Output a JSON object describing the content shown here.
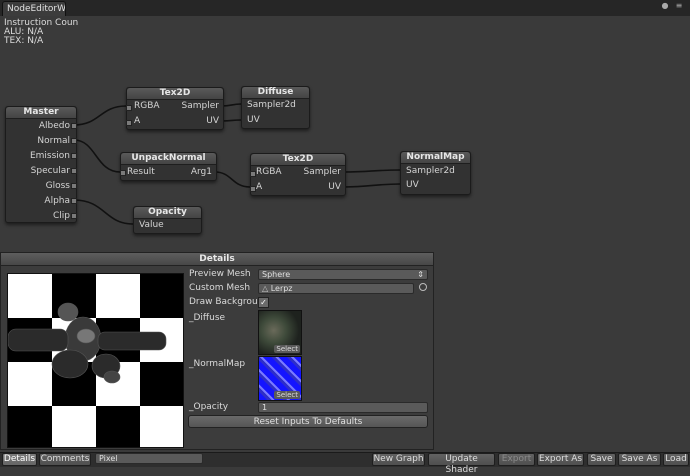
{
  "window": {
    "tab_title": "NodeEditorWin…"
  },
  "info": {
    "instruction": "Instruction Coun",
    "alu": "ALU: N/A",
    "tex": "TEX: N/A"
  },
  "nodes": {
    "master": {
      "title": "Master",
      "inputs": [
        "Albedo",
        "Normal",
        "Emission",
        "Specular",
        "Gloss",
        "Alpha",
        "Clip"
      ]
    },
    "tex2d_a": {
      "title": "Tex2D",
      "inputs": [
        "RGBA",
        "A"
      ],
      "outputs": [
        "Sampler",
        "UV"
      ]
    },
    "diffuse": {
      "title": "Diffuse",
      "outputs": [
        "Sampler2d",
        "UV"
      ]
    },
    "unpack": {
      "title": "UnpackNormal",
      "inputs": [
        "Result"
      ],
      "outputs": [
        "Arg1"
      ]
    },
    "tex2d_b": {
      "title": "Tex2D",
      "inputs": [
        "RGBA",
        "A"
      ],
      "outputs": [
        "Sampler",
        "UV"
      ]
    },
    "normalmap": {
      "title": "NormalMap",
      "outputs": [
        "Sampler2d",
        "UV"
      ]
    },
    "opacity": {
      "title": "Opacity",
      "outputs": [
        "Value"
      ]
    }
  },
  "details": {
    "title": "Details",
    "preview_mesh_label": "Preview Mesh",
    "preview_mesh_value": "Sphere",
    "custom_mesh_label": "Custom Mesh",
    "custom_mesh_value": "Lerpz",
    "draw_background_label": "Draw Backgrour",
    "draw_background_checked": true,
    "diffuse_label": "_Diffuse",
    "normalmap_label": "_NormalMap",
    "select_label": "Select",
    "opacity_label": "_Opacity",
    "opacity_value": "1",
    "reset_button": "Reset Inputs To Defaults"
  },
  "bottom_bar": {
    "tab_details": "Details",
    "tab_comments": "Comments",
    "render_mode": "Pixel",
    "new_graph": "New Graph",
    "update_shader": "Update Shader",
    "export": "Export",
    "export_as": "Export As",
    "save": "Save",
    "save_as": "Save As",
    "load": "Load"
  },
  "colors": {
    "background": "#3a3a3a",
    "node_body": "#323232",
    "wire": "#111111",
    "normal_texture": "#1a1aff"
  }
}
